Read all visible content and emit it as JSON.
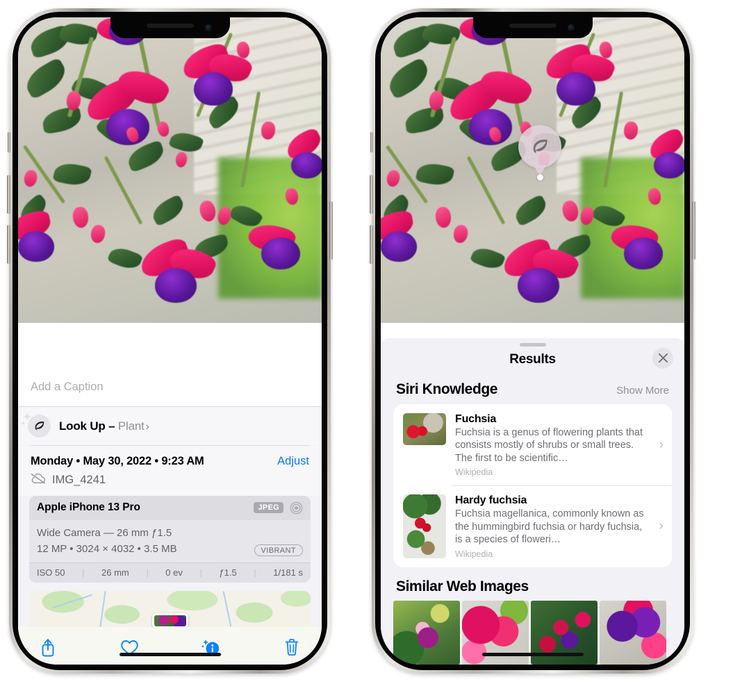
{
  "left_phone": {
    "caption_field": {
      "placeholder": "Add a Caption",
      "value": ""
    },
    "lookup_row": {
      "icon": "leaf-icon",
      "label": "Look Up –",
      "category": "Plant",
      "chevron": "›"
    },
    "date_row": {
      "date_text": "Monday • May 30, 2022 • 9:23 AM",
      "adjust_label": "Adjust"
    },
    "file_row": {
      "icon": "cloud-slash-icon",
      "file_name": "IMG_4241"
    },
    "camera_card": {
      "device": "Apple iPhone 13 Pro",
      "format_badge": "JPEG",
      "aperture_icon": "aperture-icon",
      "lens_line": "Wide Camera — 26 mm ƒ1.5",
      "spec_line": "12 MP • 3024 × 4032 • 3.5 MB",
      "style_badge": "VIBRANT",
      "exif": [
        "ISO 50",
        "26 mm",
        "0 ev",
        "ƒ1.5",
        "1/181 s"
      ]
    },
    "toolbar": [
      {
        "name": "share-icon",
        "label": "Share"
      },
      {
        "name": "heart-icon",
        "label": "Favorite"
      },
      {
        "name": "info-sparkle-icon",
        "label": "Info"
      },
      {
        "name": "trash-icon",
        "label": "Delete"
      }
    ]
  },
  "right_phone": {
    "marker": {
      "icon": "leaf-icon"
    },
    "sheet": {
      "title": "Results",
      "close_icon": "close-icon",
      "sections": [
        {
          "title": "Siri Knowledge",
          "action_label": "Show More",
          "items": [
            {
              "title": "Fuchsia",
              "description": "Fuchsia is a genus of flowering plants that consists mostly of shrubs or small trees. The first to be scientific…",
              "source": "Wikipedia",
              "chevron": "›"
            },
            {
              "title": "Hardy fuchsia",
              "description": "Fuchsia magellanica, commonly known as the hummingbird fuchsia or hardy fuchsia, is a species of floweri…",
              "source": "Wikipedia",
              "chevron": "›"
            }
          ]
        },
        {
          "title": "Similar Web Images",
          "thumbnails": [
            "web-image-1",
            "web-image-2",
            "web-image-3",
            "web-image-4"
          ]
        }
      ]
    }
  },
  "colors": {
    "accent_blue": "#007aff",
    "sheet_bg": "#f1f1f6",
    "card_bg": "#ffffff",
    "secondary_text": "#8e8e93"
  }
}
